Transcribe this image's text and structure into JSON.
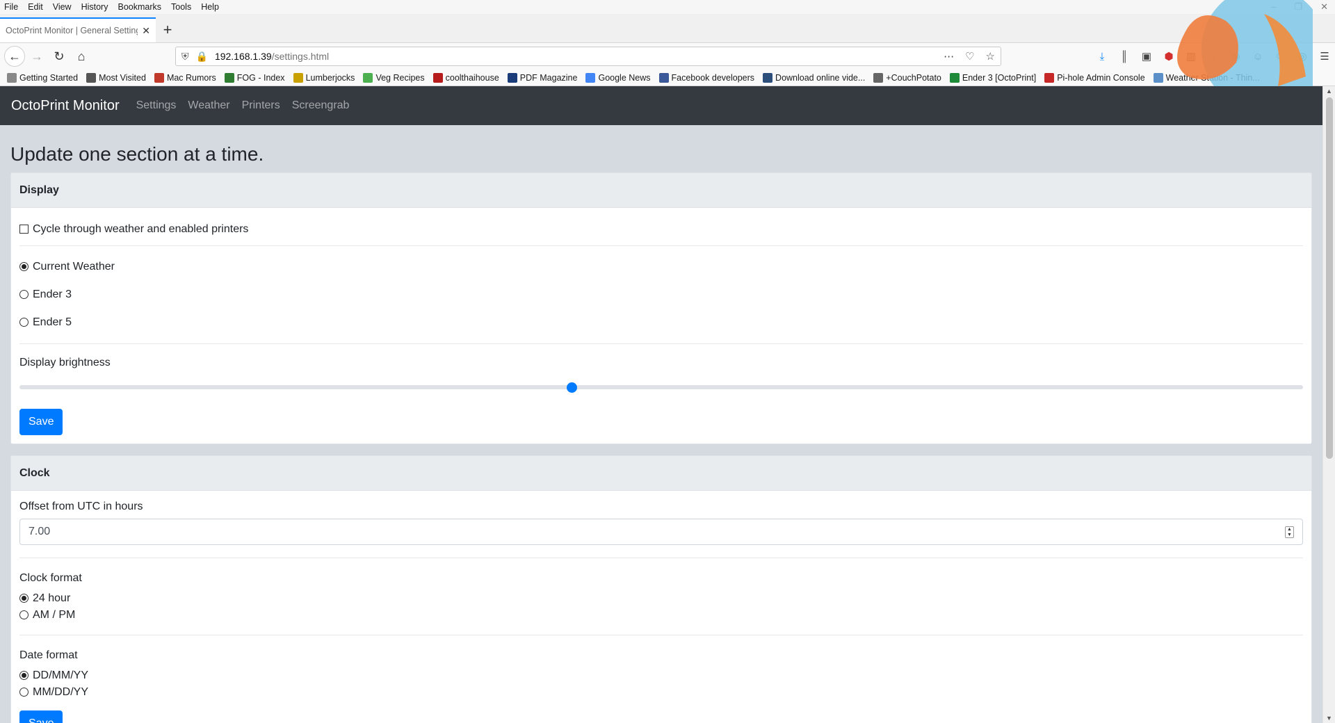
{
  "browser": {
    "menu": [
      "File",
      "Edit",
      "View",
      "History",
      "Bookmarks",
      "Tools",
      "Help"
    ],
    "tab_title": "OctoPrint Monitor | General Setting",
    "url_host": "192.168.1.39",
    "url_path": "/settings.html",
    "bookmarks": [
      {
        "label": "Getting Started",
        "color": "#888888"
      },
      {
        "label": "Most Visited",
        "color": "#555555"
      },
      {
        "label": "Mac Rumors",
        "color": "#c0392b"
      },
      {
        "label": "FOG - Index",
        "color": "#2e7d32"
      },
      {
        "label": "Lumberjocks",
        "color": "#c8a000"
      },
      {
        "label": "Veg Recipes",
        "color": "#4caf50"
      },
      {
        "label": "coolthaihouse",
        "color": "#b71c1c"
      },
      {
        "label": "PDF Magazine",
        "color": "#1a3d7a"
      },
      {
        "label": "Google News",
        "color": "#4285f4"
      },
      {
        "label": "Facebook developers",
        "color": "#3b5998"
      },
      {
        "label": "Download online vide...",
        "color": "#2c4f7c"
      },
      {
        "label": "+CouchPotato",
        "color": "#666666"
      },
      {
        "label": "Ender 3 [OctoPrint]",
        "color": "#1e8a3a"
      },
      {
        "label": "Pi-hole Admin Console",
        "color": "#c62828"
      },
      {
        "label": "Weather Station - Thin...",
        "color": "#5b8fc7"
      }
    ]
  },
  "app": {
    "brand": "OctoPrint Monitor",
    "nav": [
      "Settings",
      "Weather",
      "Printers",
      "Screengrab"
    ]
  },
  "page": {
    "heading": "Update one section at a time."
  },
  "display": {
    "title": "Display",
    "cycle_label": "Cycle through weather and enabled printers",
    "cycle_checked": false,
    "options": [
      {
        "label": "Current Weather",
        "selected": true
      },
      {
        "label": "Ender 3",
        "selected": false
      },
      {
        "label": "Ender 5",
        "selected": false
      }
    ],
    "brightness_label": "Display brightness",
    "brightness_fraction": 0.43,
    "save_label": "Save"
  },
  "clock": {
    "title": "Clock",
    "offset_label": "Offset from UTC in hours",
    "offset_value": "7.00",
    "format_label": "Clock format",
    "format_options": [
      {
        "label": "24 hour",
        "selected": true
      },
      {
        "label": "AM / PM",
        "selected": false
      }
    ],
    "date_label": "Date format",
    "date_options": [
      {
        "label": "DD/MM/YY",
        "selected": true
      },
      {
        "label": "MM/DD/YY",
        "selected": false
      }
    ],
    "save_label": "Save"
  },
  "colors": {
    "primary": "#007bff",
    "navbar": "#343a40",
    "page_bg": "#d5d9e0"
  }
}
